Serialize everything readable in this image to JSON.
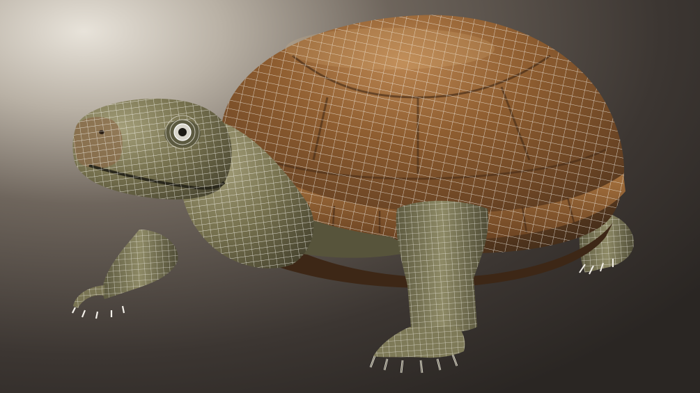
{
  "scene": {
    "subject": "turtle-wireframe-render",
    "colors": {
      "background_light": "#d8d2c8",
      "background_dark": "#2f2a27",
      "shell_base": "#8a5a2c",
      "shell_dark": "#4a3420",
      "shell_highlight": "#c08a4a",
      "skin_base": "#6e6a48",
      "skin_dark": "#3e3c2a",
      "skin_light": "#9c9670",
      "wire": "#f4f1ea"
    }
  }
}
